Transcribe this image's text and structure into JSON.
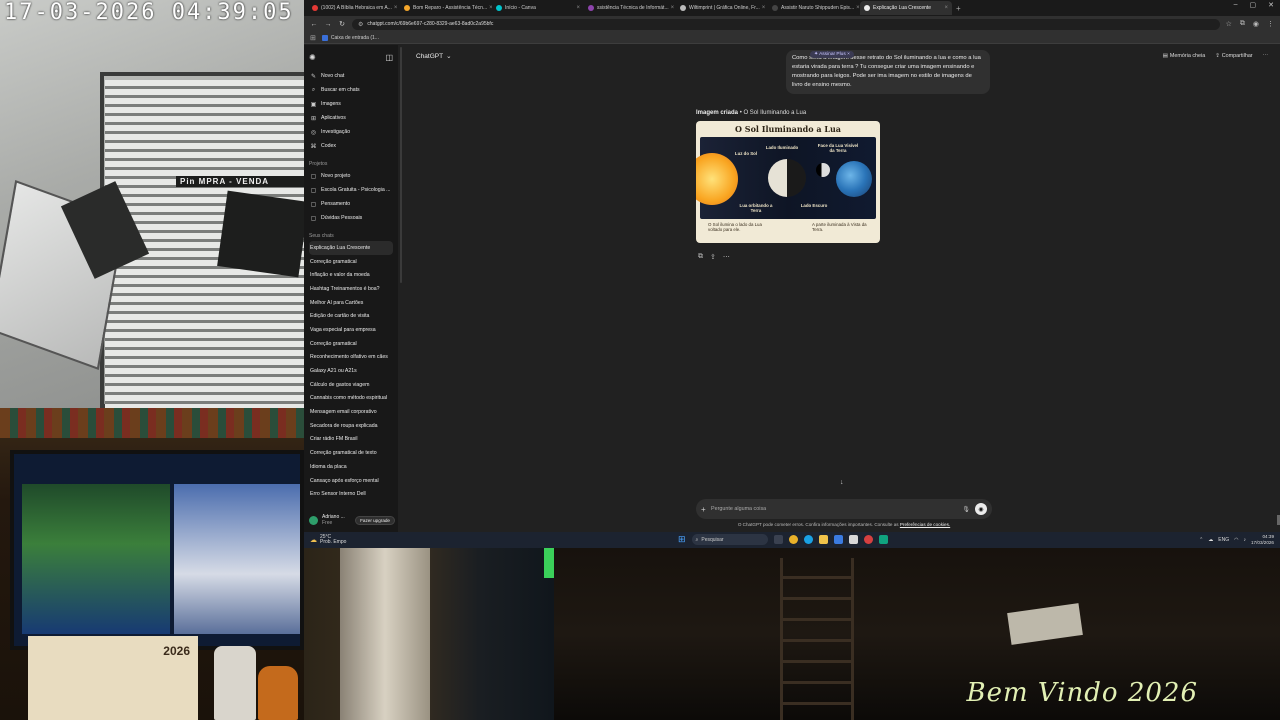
{
  "overlay": {
    "clock": "17-03-2026  04:39:05",
    "shop_sign": "Pin  MPRA - VENDA",
    "calendar_year": "2026",
    "welcome": "Bem Vindo 2026"
  },
  "browser": {
    "tabs": [
      {
        "label": "(1002) A Bíblia Hebraica em A...",
        "color": "#e53935"
      },
      {
        "label": "Bom Reparo - Assistência Técn...",
        "color": "#f4a62a"
      },
      {
        "label": "Início - Canva",
        "color": "#00c4cc"
      },
      {
        "label": "ssistência Técnica de Informát...",
        "color": "#8e44ad"
      },
      {
        "label": "Wiltimprint | Gráfica Online, Fr...",
        "color": "#bbbbbb"
      },
      {
        "label": "Assistir Naruto Shippuden Epis...",
        "color": "#444444"
      },
      {
        "label": "Explicação Lua Crescente",
        "color": "#ececec"
      }
    ],
    "url": "chatgpt.com/c/69b6e697-c280-8329-ae63-8ad0c2a95bfc",
    "bookmark": "Caixa de entrada (1..."
  },
  "sidebar": {
    "nav": [
      {
        "label": "Novo chat",
        "icon": "✎"
      },
      {
        "label": "Buscar em chats",
        "icon": "⌕"
      },
      {
        "label": "Imagens",
        "icon": "▣"
      },
      {
        "label": "Aplicativos",
        "icon": "⊞"
      },
      {
        "label": "Investigação",
        "icon": "◎"
      },
      {
        "label": "Codex",
        "icon": "⌘"
      }
    ],
    "projects_heading": "Projetos",
    "projects": [
      {
        "label": "Novo projeto",
        "icon": "▢"
      },
      {
        "label": "Escola Gratuita - Psicologia ...",
        "icon": "▢"
      },
      {
        "label": "Pensamento",
        "icon": "▢"
      },
      {
        "label": "Dúvidas Pessoais",
        "icon": "▢"
      }
    ],
    "chats_heading": "Seus chats",
    "chats": [
      "Explicação Lua Crescente",
      "Correção gramatical",
      "Inflação e valor da moeda",
      "Hashtag Treinamentos é boa?",
      "Melhor AI para Cartões",
      "Edição de cartão de visita",
      "Vaga especial para empresa",
      "Correção gramatical",
      "Reconhecimento olfativo em cães",
      "Galaxy A21 ou A21s",
      "Cálculo de gastos viagem",
      "Cannabis como método espiritual",
      "Mensagem email corporativo",
      "Secadora de roupa explicada",
      "Criar rádio FM Brasil",
      "Correção gramatical de texto",
      "Idioma da placa",
      "Cansaço após esforço mental",
      "Erro Sensor Interno Dell"
    ],
    "user_name": "Adriano ...",
    "user_plan": "Free",
    "upgrade": "Fazer upgrade"
  },
  "main": {
    "model": "ChatGPT",
    "memory": "Memória cheia",
    "share": "Compartilhar",
    "plus_pill": "✦ Assinar Plus  ×",
    "user_message": "Como seria a imagem desse retrato do Sol iluminando a lua e como a lua estaria virada para terra ? Tu consegue criar uma imagem ensinando e mostrando para leigos. Pode ser ima imagem no estilo de imagens de livro de ensino mesmo.",
    "image_caption_bold": "Imagem criada",
    "image_caption": " • O Sol Iluminando a Lua",
    "image": {
      "title": "O Sol Iluminando a Lua",
      "sun_light": "Luz do Sol",
      "lit_side": "Lado Iluminado",
      "visible_face": "Face da Lua Visível da Terra",
      "dark_side": "Lado Escuro",
      "orbit": "Lua orbitando a Terra",
      "foot_left": "O Sol ilumina o lado da Lua voltado para ele.",
      "foot_right": "A parte iluminada à Vista da Terra."
    },
    "placeholder": "Pergunte alguma coisa",
    "disclaimer": "O ChatGPT pode cometer erros. Confira informações importantes. Consulte as ",
    "disclaimer_link": "Preferências de cookies."
  },
  "taskbar": {
    "temp": "25°C",
    "weather": "Prob. Empo",
    "search": "Pesquisar",
    "lang": "ENG",
    "time": "04:39",
    "date": "17/03/2026"
  }
}
